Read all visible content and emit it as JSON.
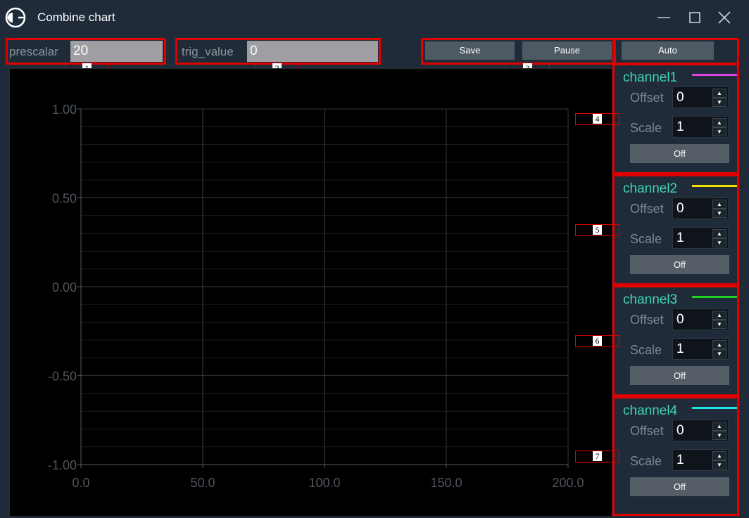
{
  "window": {
    "title": "Combine chart",
    "icon": "app-logo-icon",
    "controls": [
      "minimize-icon",
      "maximize-icon",
      "close-icon"
    ]
  },
  "toolbar": {
    "prescalar_label": "prescalar",
    "prescalar_value": "20",
    "trig_label": "trig_value",
    "trig_value": "0",
    "save_label": "Save",
    "pause_label": "Pause",
    "auto_label": "Auto"
  },
  "annotations": [
    "1",
    "2",
    "3",
    "4",
    "5",
    "6",
    "7"
  ],
  "chart_data": {
    "type": "line",
    "x_ticks": [
      "0.0",
      "50.0",
      "100.0",
      "150.0",
      "200.0"
    ],
    "y_ticks": [
      "1.00",
      "0.50",
      "0.00",
      "-0.50",
      "-1.00"
    ],
    "xlim": [
      0,
      200
    ],
    "ylim": [
      -1,
      1
    ],
    "grid": true,
    "series": []
  },
  "channels": [
    {
      "name": "channel1",
      "color": "#e040e0",
      "offset_label": "Offset",
      "offset_value": "0",
      "scale_label": "Scale",
      "scale_value": "1",
      "toggle_label": "Off"
    },
    {
      "name": "channel2",
      "color": "#f0e000",
      "offset_label": "Offset",
      "offset_value": "0",
      "scale_label": "Scale",
      "scale_value": "1",
      "toggle_label": "Off"
    },
    {
      "name": "channel3",
      "color": "#20d020",
      "offset_label": "Offset",
      "offset_value": "0",
      "scale_label": "Scale",
      "scale_value": "1",
      "toggle_label": "Off"
    },
    {
      "name": "channel4",
      "color": "#20e0e8",
      "offset_label": "Offset",
      "offset_value": "0",
      "scale_label": "Scale",
      "scale_value": "1",
      "toggle_label": "Off"
    }
  ]
}
